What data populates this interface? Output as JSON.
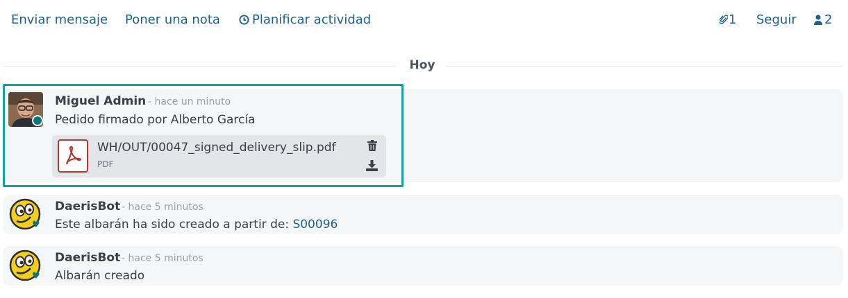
{
  "topbar": {
    "send_message": "Enviar mensaje",
    "log_note": "Poner una nota",
    "schedule_activity": "Planificar actividad",
    "attachments_count": "1",
    "follow": "Seguir",
    "followers_count": "2"
  },
  "separator": {
    "label": "Hoy"
  },
  "messages": [
    {
      "author": "Miguel Admin",
      "date": "- hace un minuto",
      "body": "Pedido firmado por Alberto García",
      "attachment": {
        "name": "WH/OUT/00047_signed_delivery_slip.pdf",
        "type": "PDF"
      }
    },
    {
      "author": "DaerisBot",
      "date": "- hace 5 minutos",
      "body_prefix": "Este albarán ha sido creado a partir de: ",
      "body_link": "S00096"
    },
    {
      "author": "DaerisBot",
      "date": "- hace 5 minutos",
      "body": "Albarán creado"
    }
  ],
  "colors": {
    "link": "#1f5f8b",
    "highlight": "#17a2a0",
    "status": "#0d7777",
    "pdf": "#b33a2e"
  }
}
